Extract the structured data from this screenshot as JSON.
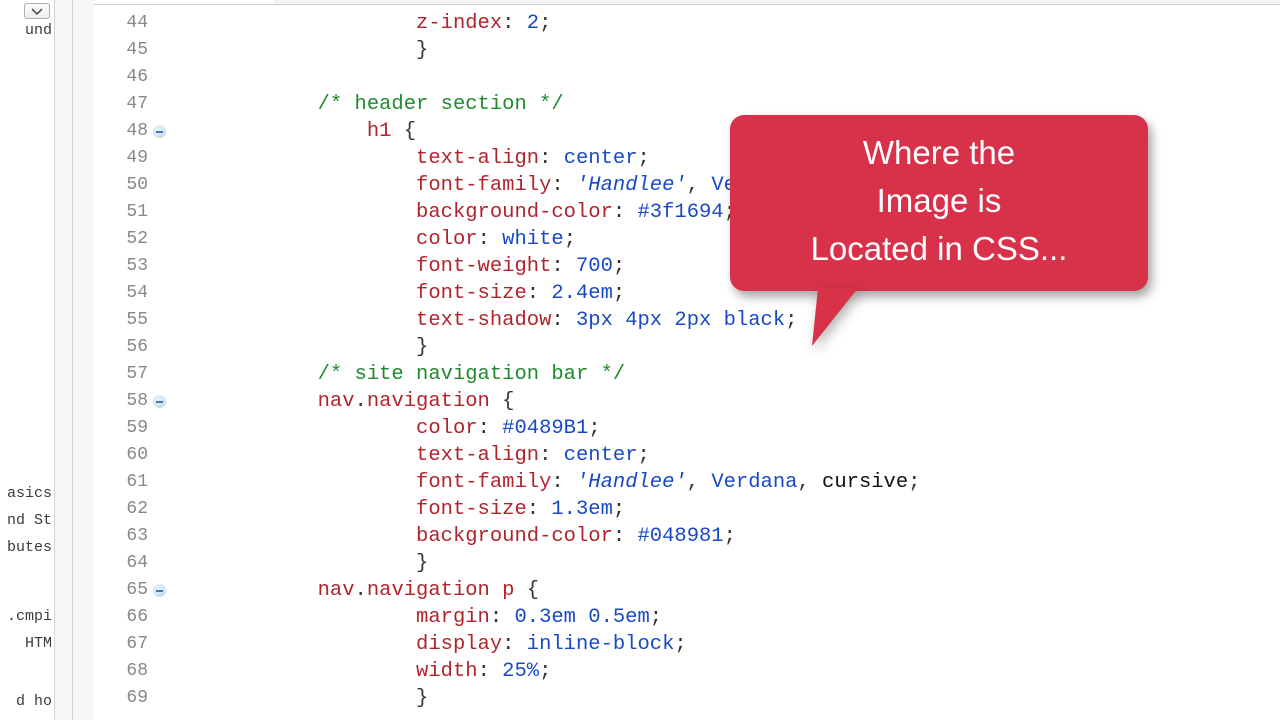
{
  "sidebar_fragments": {
    "f0_top": "und",
    "f1": "asics",
    "f2": "nd St",
    "f3": "butes",
    "f4": ".cmpi",
    "f5": "HTM",
    "f6": "d ho"
  },
  "gutter": {
    "start": 44,
    "end": 69,
    "foldable": [
      48,
      58,
      65
    ]
  },
  "code_lines": [
    {
      "n": 44,
      "ind": 10,
      "seg": [
        [
          "st",
          "z-index"
        ],
        [
          "pn",
          ": "
        ],
        [
          "vl",
          "2"
        ],
        [
          "pn",
          ";"
        ]
      ]
    },
    {
      "n": 45,
      "ind": 10,
      "seg": [
        [
          "pn",
          "}"
        ]
      ]
    },
    {
      "n": 46,
      "ind": 0,
      "seg": []
    },
    {
      "n": 47,
      "ind": 6,
      "seg": [
        [
          "cm",
          "/* header section */"
        ]
      ]
    },
    {
      "n": 48,
      "ind": 8,
      "seg": [
        [
          "st",
          "h1 "
        ],
        [
          "pn",
          "{"
        ]
      ]
    },
    {
      "n": 49,
      "ind": 10,
      "seg": [
        [
          "st",
          "text-align"
        ],
        [
          "pn",
          ": "
        ],
        [
          "vl",
          "center"
        ],
        [
          "pn",
          ";"
        ]
      ]
    },
    {
      "n": 50,
      "ind": 10,
      "seg": [
        [
          "st",
          "font-family"
        ],
        [
          "pn",
          ": "
        ],
        [
          "it",
          "'Handlee'"
        ],
        [
          "pn",
          ", "
        ],
        [
          "vl",
          "Verdana"
        ],
        [
          "pn",
          ","
        ]
      ]
    },
    {
      "n": 51,
      "ind": 10,
      "seg": [
        [
          "st",
          "background-color"
        ],
        [
          "pn",
          ": "
        ],
        [
          "vl",
          "#3f1694"
        ],
        [
          "pn",
          ";"
        ]
      ]
    },
    {
      "n": 52,
      "ind": 10,
      "seg": [
        [
          "st",
          "color"
        ],
        [
          "pn",
          ": "
        ],
        [
          "vl",
          "white"
        ],
        [
          "pn",
          ";"
        ]
      ]
    },
    {
      "n": 53,
      "ind": 10,
      "seg": [
        [
          "st",
          "font-weight"
        ],
        [
          "pn",
          ": "
        ],
        [
          "vl",
          "700"
        ],
        [
          "pn",
          ";"
        ]
      ]
    },
    {
      "n": 54,
      "ind": 10,
      "seg": [
        [
          "st",
          "font-size"
        ],
        [
          "pn",
          ": "
        ],
        [
          "vl",
          "2.4em"
        ],
        [
          "pn",
          ";"
        ]
      ]
    },
    {
      "n": 55,
      "ind": 10,
      "seg": [
        [
          "st",
          "text-shadow"
        ],
        [
          "pn",
          ": "
        ],
        [
          "vl",
          "3px 4px 2px black"
        ],
        [
          "pn",
          ";"
        ]
      ]
    },
    {
      "n": 56,
      "ind": 10,
      "seg": [
        [
          "pn",
          "}"
        ]
      ]
    },
    {
      "n": 57,
      "ind": 6,
      "seg": [
        [
          "cm",
          "/* site navigation bar */"
        ]
      ]
    },
    {
      "n": 58,
      "ind": 6,
      "seg": [
        [
          "st",
          "nav"
        ],
        [
          "pn",
          "."
        ],
        [
          "st",
          "navigation "
        ],
        [
          "pn",
          "{"
        ]
      ]
    },
    {
      "n": 59,
      "ind": 10,
      "seg": [
        [
          "st",
          "color"
        ],
        [
          "pn",
          ": "
        ],
        [
          "vl",
          "#0489B1"
        ],
        [
          "pn",
          ";"
        ]
      ]
    },
    {
      "n": 60,
      "ind": 10,
      "seg": [
        [
          "st",
          "text-align"
        ],
        [
          "pn",
          ": "
        ],
        [
          "vl",
          "center"
        ],
        [
          "pn",
          ";"
        ]
      ]
    },
    {
      "n": 61,
      "ind": 10,
      "seg": [
        [
          "st",
          "font-family"
        ],
        [
          "pn",
          ": "
        ],
        [
          "it",
          "'Handlee'"
        ],
        [
          "pn",
          ", "
        ],
        [
          "vl",
          "Verdana"
        ],
        [
          "pn",
          ", "
        ],
        [
          "id",
          "cursive"
        ],
        [
          "pn",
          ";"
        ]
      ]
    },
    {
      "n": 62,
      "ind": 10,
      "seg": [
        [
          "st",
          "font-size"
        ],
        [
          "pn",
          ": "
        ],
        [
          "vl",
          "1.3em"
        ],
        [
          "pn",
          ";"
        ]
      ]
    },
    {
      "n": 63,
      "ind": 10,
      "seg": [
        [
          "st",
          "background-color"
        ],
        [
          "pn",
          ": "
        ],
        [
          "vl",
          "#048981"
        ],
        [
          "pn",
          ";"
        ]
      ]
    },
    {
      "n": 64,
      "ind": 10,
      "seg": [
        [
          "pn",
          "}"
        ]
      ]
    },
    {
      "n": 65,
      "ind": 6,
      "seg": [
        [
          "st",
          "nav"
        ],
        [
          "pn",
          "."
        ],
        [
          "st",
          "navigation p "
        ],
        [
          "pn",
          "{"
        ]
      ]
    },
    {
      "n": 66,
      "ind": 10,
      "seg": [
        [
          "st",
          "margin"
        ],
        [
          "pn",
          ": "
        ],
        [
          "vl",
          "0.3em 0.5em"
        ],
        [
          "pn",
          ";"
        ]
      ]
    },
    {
      "n": 67,
      "ind": 10,
      "seg": [
        [
          "st",
          "display"
        ],
        [
          "pn",
          ": "
        ],
        [
          "vl",
          "inline-block"
        ],
        [
          "pn",
          ";"
        ]
      ]
    },
    {
      "n": 68,
      "ind": 10,
      "seg": [
        [
          "st",
          "width"
        ],
        [
          "pn",
          ": "
        ],
        [
          "vl",
          "25%"
        ],
        [
          "pn",
          ";"
        ]
      ]
    },
    {
      "n": 69,
      "ind": 10,
      "seg": [
        [
          "pn",
          "}"
        ]
      ]
    }
  ],
  "callout": {
    "line1": "Where the",
    "line2": "Image is",
    "line3": "Located in CSS..."
  }
}
